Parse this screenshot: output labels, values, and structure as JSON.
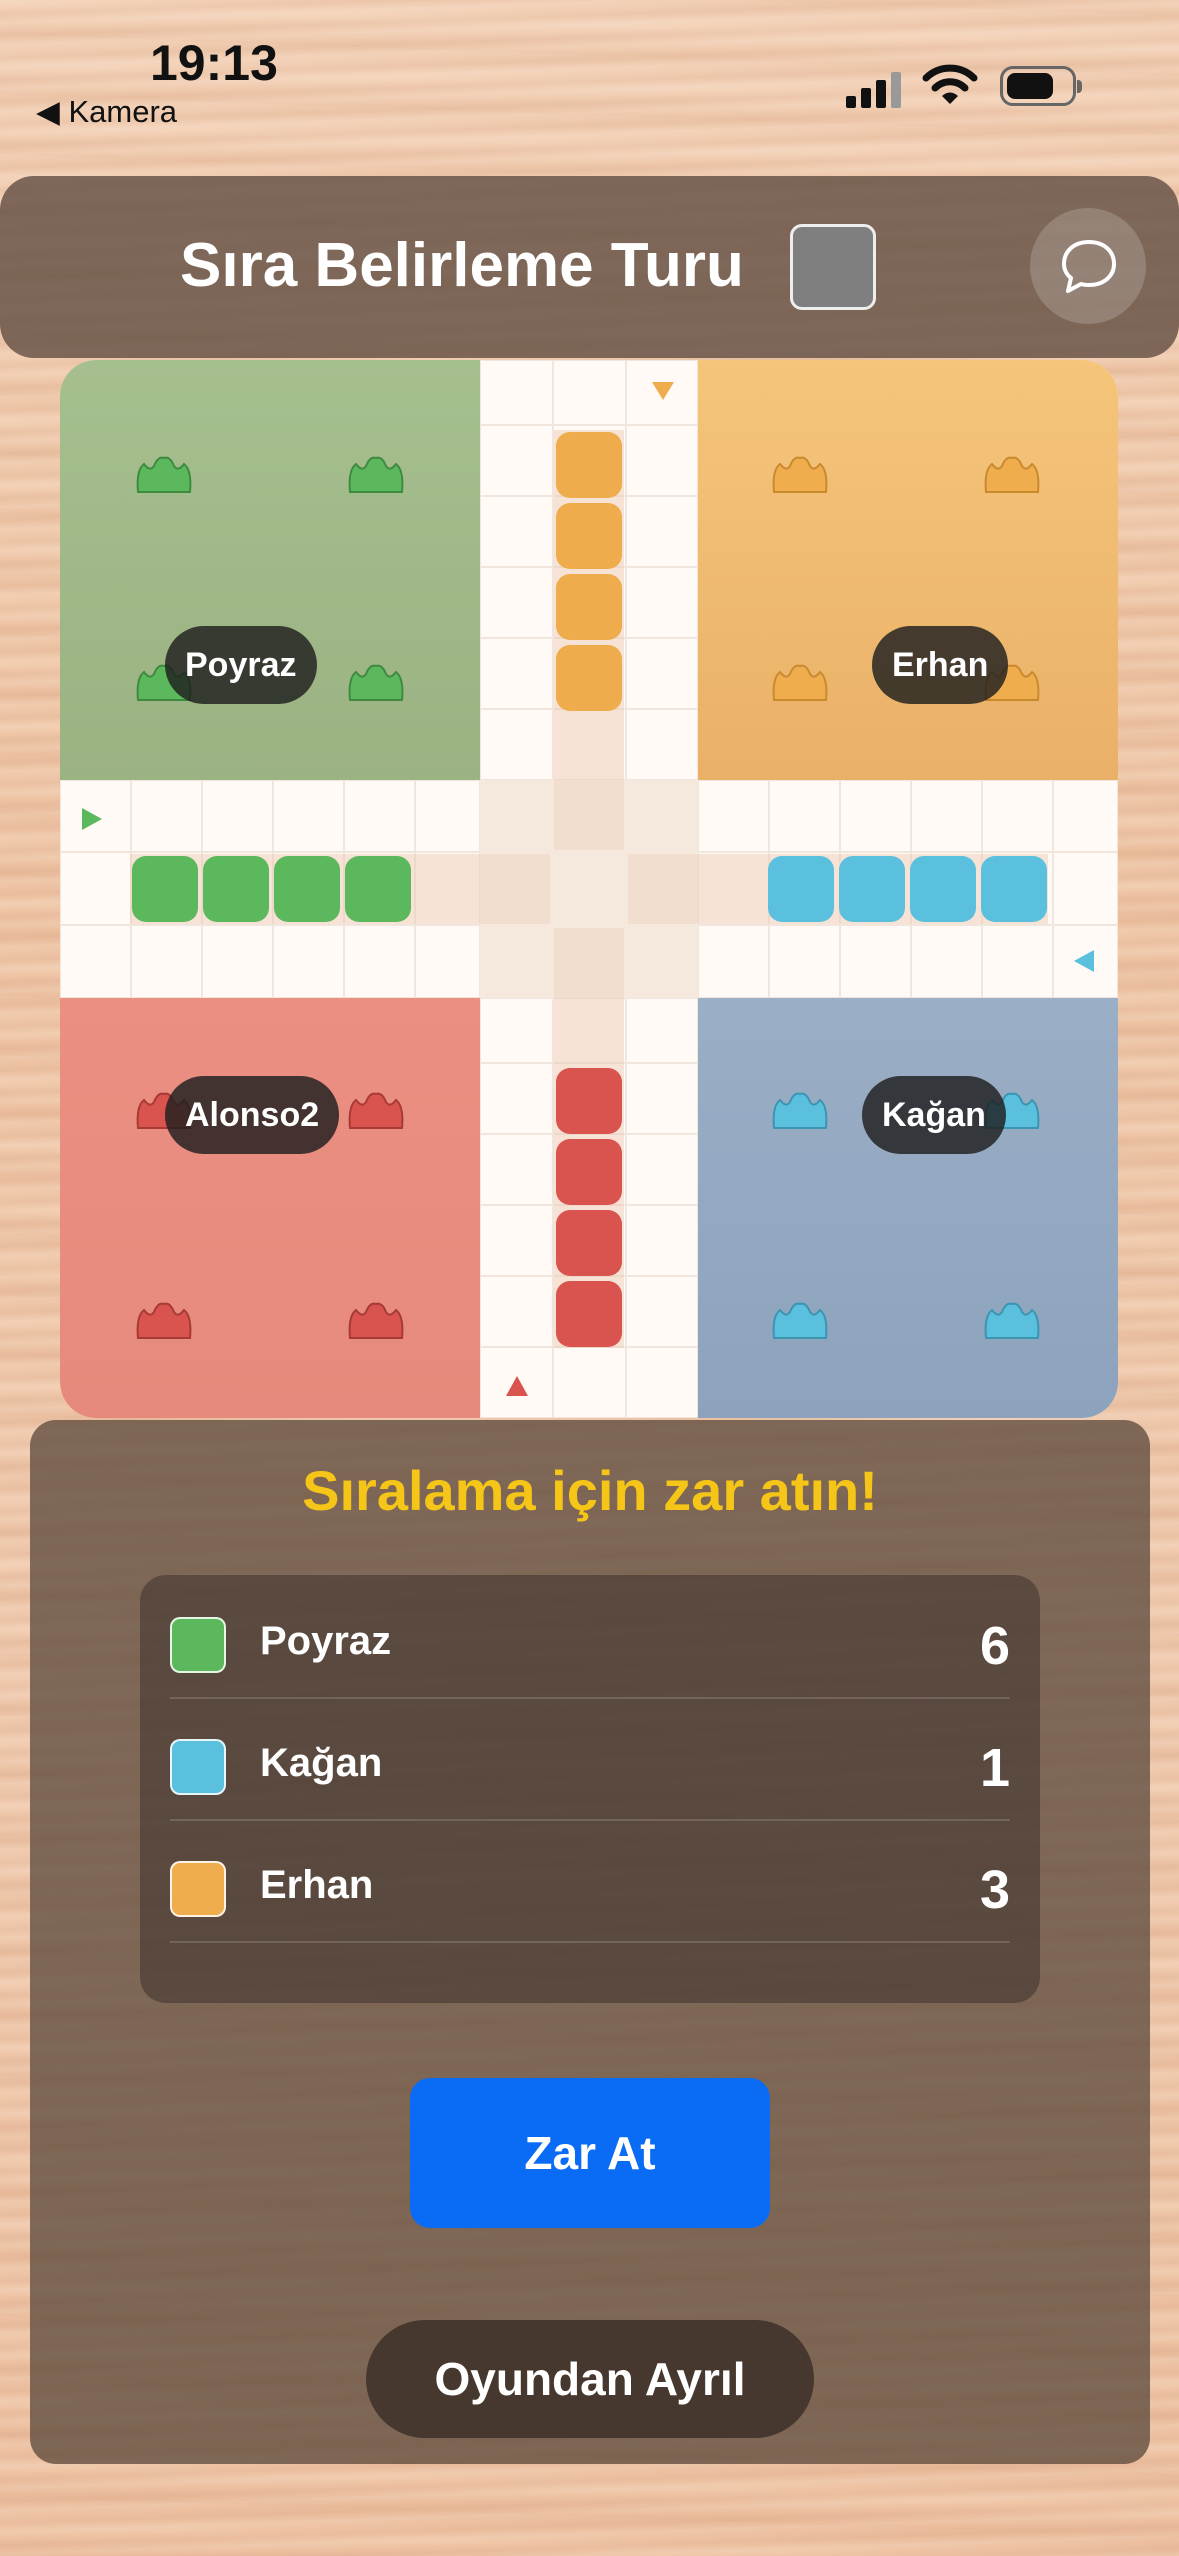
{
  "status_bar": {
    "time": "19:13",
    "back_label": "Kamera"
  },
  "header": {
    "title": "Sıra Belirleme Turu",
    "chat_icon": "chat-bubble-icon"
  },
  "board": {
    "players": [
      {
        "name": "Poyraz",
        "color": "#5cb85c",
        "base": "top-left"
      },
      {
        "name": "Erhan",
        "color": "#f0ad4e",
        "base": "top-right"
      },
      {
        "name": "Alonso2",
        "color": "#d9534f",
        "base": "bottom-left"
      },
      {
        "name": "Kağan",
        "color": "#5bc0de",
        "base": "bottom-right"
      }
    ]
  },
  "panel": {
    "title": "Sıralama için zar atın!",
    "scores": [
      {
        "name": "Poyraz",
        "score": "6",
        "color": "#5cb85c"
      },
      {
        "name": "Kağan",
        "score": "1",
        "color": "#5bc0de"
      },
      {
        "name": "Erhan",
        "score": "3",
        "color": "#f0ad4e"
      }
    ],
    "roll_button": "Zar At",
    "leave_button": "Oyundan Ayrıl"
  }
}
